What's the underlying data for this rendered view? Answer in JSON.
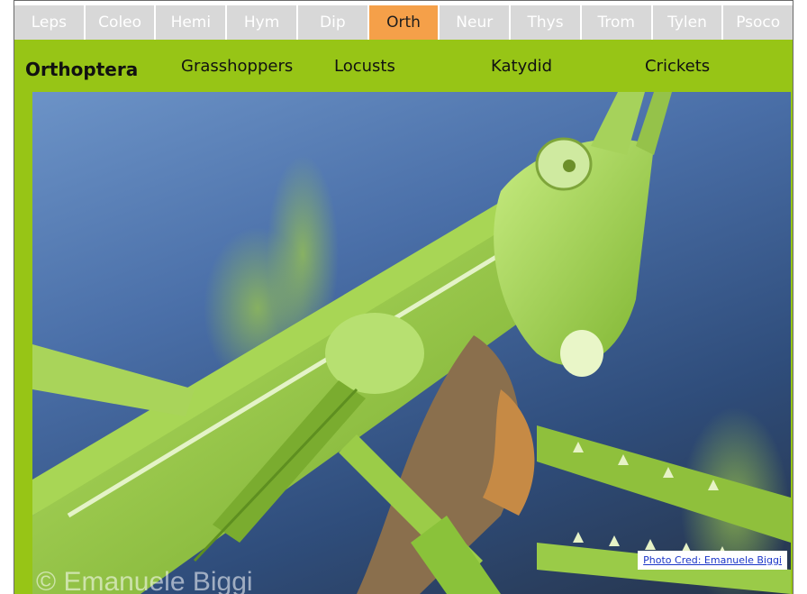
{
  "tabs": [
    {
      "label": "Leps",
      "active": false
    },
    {
      "label": "Coleo",
      "active": false
    },
    {
      "label": "Hemi",
      "active": false
    },
    {
      "label": "Hym",
      "active": false
    },
    {
      "label": "Dip",
      "active": false
    },
    {
      "label": "Orth",
      "active": true
    },
    {
      "label": "Neur",
      "active": false
    },
    {
      "label": "Thys",
      "active": false
    },
    {
      "label": "Trom",
      "active": false
    },
    {
      "label": "Tylen",
      "active": false
    },
    {
      "label": "Psoco",
      "active": false
    }
  ],
  "subnav": {
    "title": "Orthoptera",
    "links": [
      "Grasshoppers",
      "Locusts",
      "Katydid",
      "Crickets"
    ]
  },
  "photo": {
    "credit": "Photo Cred: Emanuele Biggi",
    "watermark": "© Emanuele Biggi"
  },
  "colors": {
    "tab_inactive": "#d8d8d8",
    "tab_active": "#f5a049",
    "band_green": "#97c516"
  }
}
